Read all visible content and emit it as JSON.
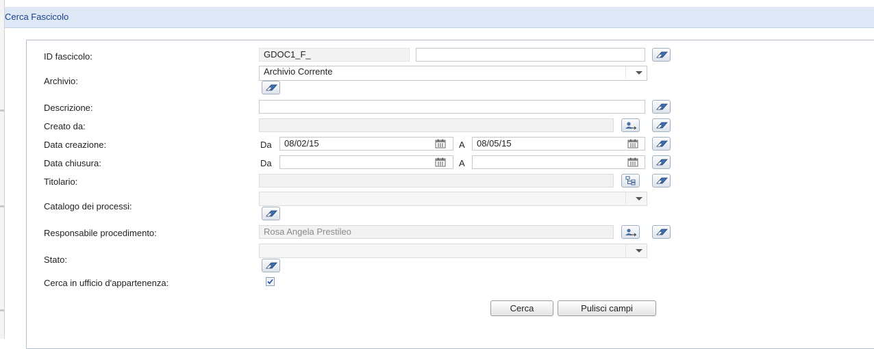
{
  "window": {
    "title": "Cerca Fascicolo"
  },
  "form": {
    "id_fascicolo": {
      "label": "ID fascicolo:",
      "prefix": "GDOC1_F_",
      "value": ""
    },
    "archivio": {
      "label": "Archivio:",
      "value": "Archivio Corrente"
    },
    "descrizione": {
      "label": "Descrizione:",
      "value": ""
    },
    "creato_da": {
      "label": "Creato da:",
      "value": ""
    },
    "data_creazione": {
      "label": "Data creazione:",
      "from_label": "Da",
      "from": "08/02/15",
      "to_label": "A",
      "to": "08/05/15"
    },
    "data_chiusura": {
      "label": "Data chiusura:",
      "from_label": "Da",
      "from": "",
      "to_label": "A",
      "to": ""
    },
    "titolario": {
      "label": "Titolario:",
      "value": ""
    },
    "catalogo": {
      "label": "Catalogo dei processi:",
      "value": ""
    },
    "responsabile": {
      "label": "Responsabile procedimento:",
      "value": "Rosa Angela Prestileo"
    },
    "stato": {
      "label": "Stato:",
      "value": ""
    },
    "cerca_ufficio": {
      "label": "Cerca in ufficio d'appartenenza:",
      "checked": true
    }
  },
  "buttons": {
    "search": "Cerca",
    "clear": "Pulisci campi"
  },
  "icons": {
    "eraser": "eraser-icon",
    "calendar": "calendar-icon",
    "user_lookup": "user-lookup-icon",
    "tree": "tree-icon",
    "dropdown": "chevron-down-icon"
  },
  "colors": {
    "title_bg": "#dfe8f6",
    "title_text": "#15428b",
    "panel_border": "#b5c1cf"
  }
}
